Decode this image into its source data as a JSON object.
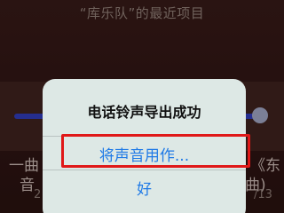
{
  "header": {
    "title": "“库乐队”的最近项目"
  },
  "background_items": {
    "left_title_fragment": "一曲",
    "left_subtitle_fragment": "音",
    "left_date_fragment": "2",
    "right_title_fragment": "《东",
    "right_subtitle_fragment": "曲)",
    "right_date_fragment": "/13"
  },
  "alert": {
    "title": "电话铃声导出成功",
    "use_sound_label": "将声音用作...",
    "ok_label": "好"
  },
  "colors": {
    "accent": "#1f7ae6",
    "highlight": "#e01818",
    "dialog_bg": "#dde8e5"
  }
}
